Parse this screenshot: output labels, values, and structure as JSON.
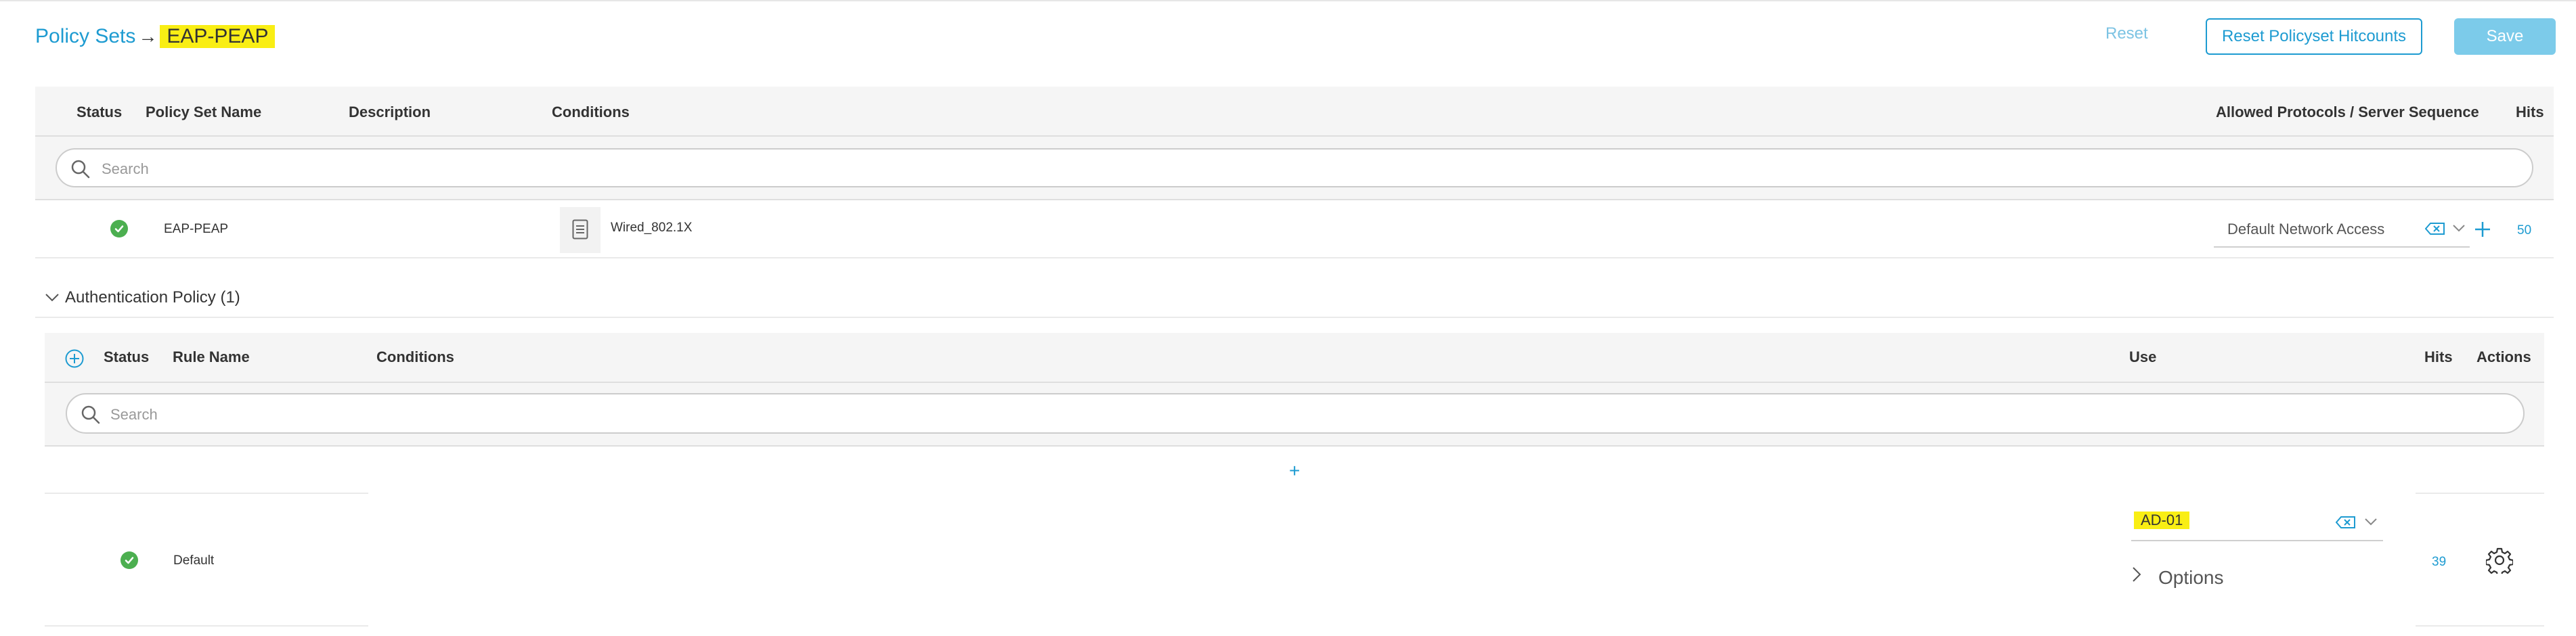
{
  "header": {
    "breadcrumb_root": "Policy Sets",
    "breadcrumb_arrow": "→",
    "breadcrumb_current": "EAP-PEAP",
    "reset_label": "Reset",
    "reset_hitcounts_label": "Reset Policyset Hitcounts",
    "save_label": "Save"
  },
  "policy_sets_table": {
    "columns": {
      "status": "Status",
      "name": "Policy Set Name",
      "description": "Description",
      "conditions": "Conditions",
      "allowed": "Allowed Protocols / Server Sequence",
      "hits": "Hits"
    },
    "search_placeholder": "Search",
    "row": {
      "name": "EAP-PEAP",
      "condition": "Wired_802.1X",
      "allowed_protocol": "Default Network Access",
      "hits": "50"
    }
  },
  "auth_policy": {
    "section_title": "Authentication Policy (1)",
    "columns": {
      "status": "Status",
      "rule_name": "Rule Name",
      "conditions": "Conditions",
      "use": "Use",
      "hits": "Hits",
      "actions": "Actions"
    },
    "search_placeholder": "Search",
    "add_glyph": "+",
    "row": {
      "rule_name": "Default",
      "use_value": "AD-01",
      "options_label": "Options",
      "hits": "39"
    }
  },
  "colors": {
    "accent": "#1d9bd1",
    "highlight": "#f9ee14",
    "success": "#4caf50",
    "save_disabled": "#7ccbea"
  }
}
